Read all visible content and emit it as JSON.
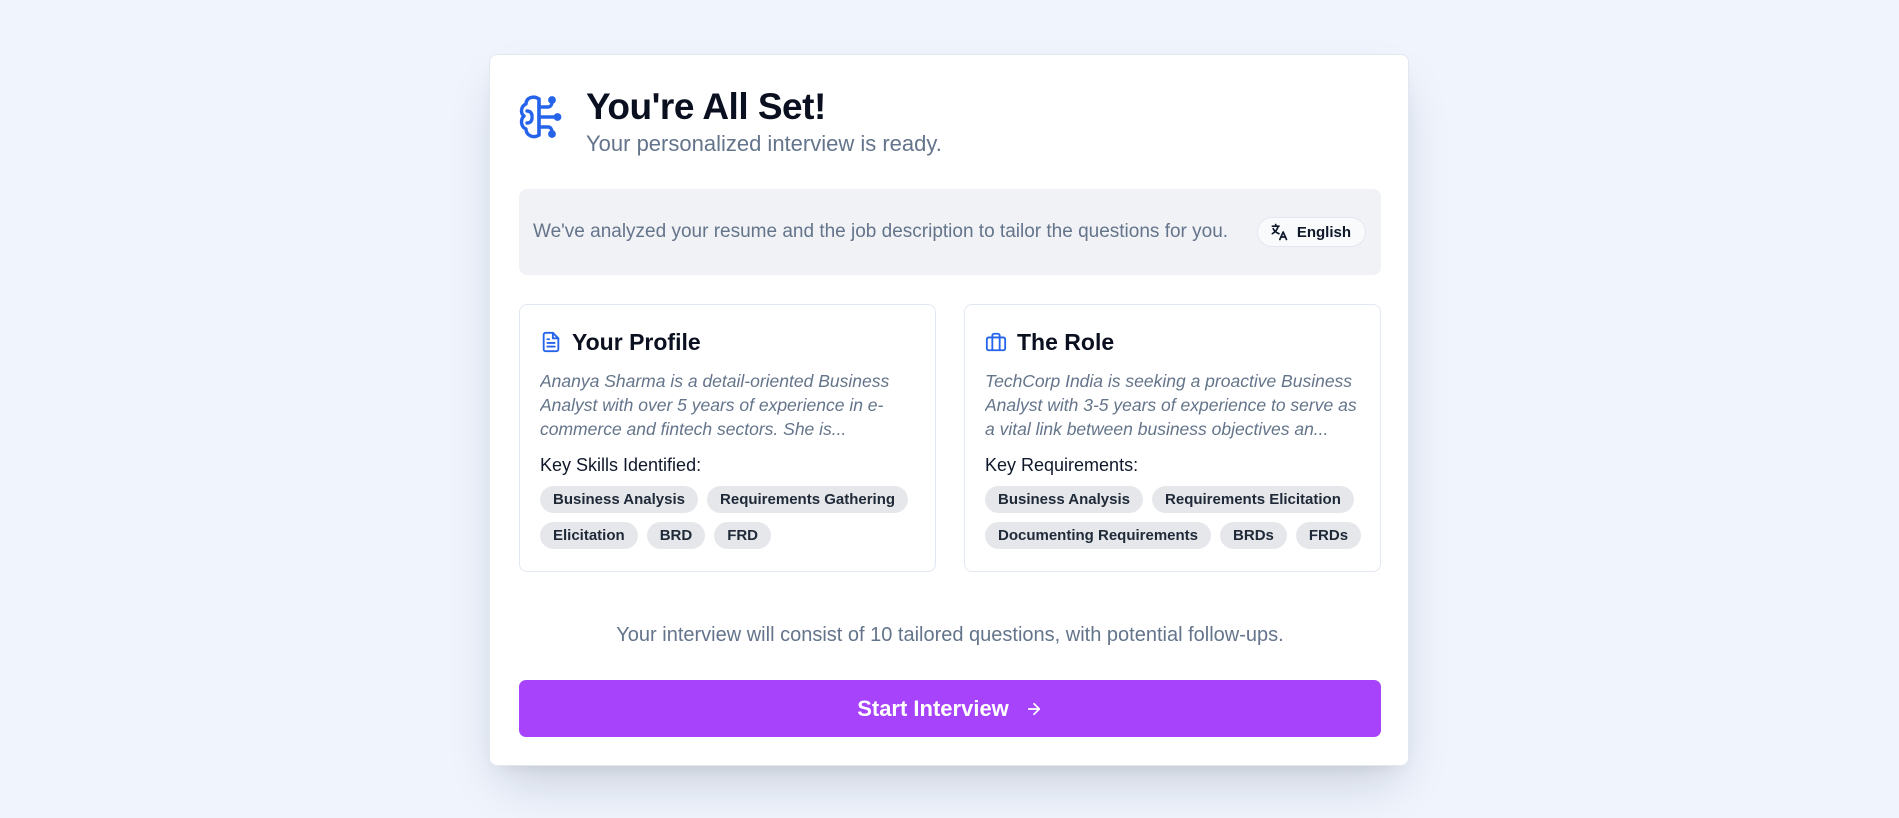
{
  "header": {
    "title": "You're All Set!",
    "subtitle": "Your personalized interview is ready.",
    "icon": "brain-icon"
  },
  "info": {
    "text": "We've analyzed your resume and the job description to tailor the questions for you.",
    "language": "English",
    "language_icon": "translate-icon"
  },
  "profile": {
    "title": "Your Profile",
    "icon": "document-icon",
    "description": "Ananya Sharma is a detail-oriented Business Analyst with over 5 years of experience in e-commerce and fintech sectors. She is...",
    "skills_label": "Key Skills Identified:",
    "skills": [
      "Business Analysis",
      "Requirements Gathering",
      "Elicitation",
      "BRD",
      "FRD"
    ]
  },
  "role": {
    "title": "The Role",
    "icon": "briefcase-icon",
    "description": "TechCorp India is seeking a proactive Business Analyst with 3-5 years of experience to serve as a vital link between business objectives an...",
    "requirements_label": "Key Requirements:",
    "requirements": [
      "Business Analysis",
      "Requirements Elicitation",
      "Documenting Requirements",
      "BRDs",
      "FRDs"
    ]
  },
  "footer": {
    "note": "Your interview will consist of 10 tailored questions, with potential follow-ups.",
    "start_label": "Start Interview",
    "start_icon": "arrow-right-icon"
  },
  "colors": {
    "accent_blue": "#2563eb",
    "button_purple": "#a743fb",
    "background": "#eff4fd"
  }
}
